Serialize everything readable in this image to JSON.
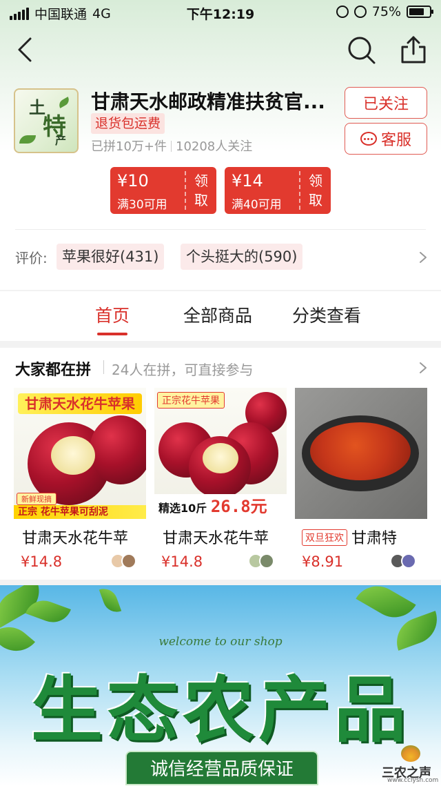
{
  "status_bar": {
    "carrier": "中国联通",
    "network": "4G",
    "time": "下午12:19",
    "battery": "75%",
    "battery_level": 0.75
  },
  "nav": {
    "back_icon": "chevron-left-icon",
    "search_icon": "search-icon",
    "share_icon": "share-icon"
  },
  "shop": {
    "logo_text": [
      "土",
      "特",
      "产"
    ],
    "name": "甘肃天水邮政精准扶贫官...",
    "return_tag": "退货包运费",
    "sold": "已拼10万+件",
    "followers": "10208人关注",
    "follow_button": "已关注",
    "service_button": "客服"
  },
  "coupons": [
    {
      "amount": "¥10",
      "condition": "满30可用",
      "claim": "领取"
    },
    {
      "amount": "¥14",
      "condition": "满40可用",
      "claim": "领取"
    }
  ],
  "reviews": {
    "label": "评价:",
    "tags": [
      "苹果很好(431)",
      "个头挺大的(590)"
    ]
  },
  "tabs": [
    "首页",
    "全部商品",
    "分类查看"
  ],
  "active_tab": 0,
  "group": {
    "title": "大家都在拼",
    "subtitle": "24人在拼，可直接参与"
  },
  "products": [
    {
      "title": "甘肃天水花牛苹",
      "price": "¥14.8",
      "img_top": "甘肃天水花牛苹果",
      "img_bottom": "正宗 花牛苹果可刮泥",
      "img_badge": "新鲜现摘"
    },
    {
      "title": "甘肃天水花牛苹",
      "price": "¥14.8",
      "img_top": "正宗花牛苹果",
      "img_label": "精选10斤",
      "img_price": "26.8元"
    },
    {
      "tag": "双旦狂欢",
      "title": "甘肃特",
      "price": "¥8.91"
    }
  ],
  "banner": {
    "welcome": "welcome to our shop",
    "title": "生态农产品",
    "ribbon": "诚信经营品质保证"
  },
  "watermark": {
    "name": "三农之声",
    "url": "www.cclysn.com"
  },
  "colors": {
    "accent": "#d9302a",
    "coupon": "#e23a2f",
    "eco_green": "#1f8a3a"
  }
}
